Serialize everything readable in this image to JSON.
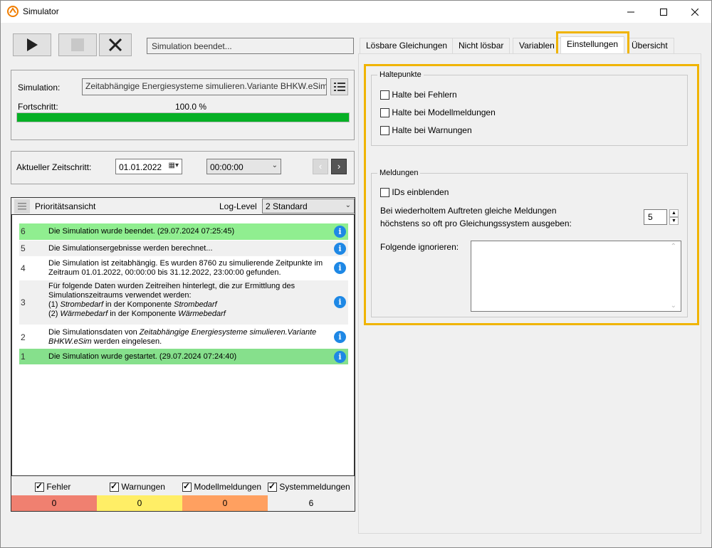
{
  "window": {
    "title": "Simulator"
  },
  "toolbar": {
    "status_text": "Simulation beendet..."
  },
  "simulation": {
    "label": "Simulation:",
    "value": "Zeitabhängige Energiesysteme simulieren.Variante BHKW.eSim",
    "progress_label": "Fortschritt:",
    "progress_text": "100.0 %",
    "progress_fraction": 1.0
  },
  "timestep": {
    "label": "Aktueller Zeitschritt:",
    "date": "01.01.2022",
    "time": "00:00:00"
  },
  "log": {
    "title": "Prioritätsansicht",
    "level_label": "Log-Level",
    "level_value": "2 Standard",
    "rows": [
      {
        "num": "6",
        "line1": "Die Simulation wurde beendet. (29.07.2024 07:25:45)"
      },
      {
        "num": "5",
        "line1": "Die Simulationsergebnisse werden berechnet..."
      },
      {
        "num": "4",
        "line1": "Die Simulation ist zeitabhängig. Es wurden 8760 zu simulierende Zeitpunkte im",
        "line2": "Zeitraum 01.01.2022, 00:00:00 bis 31.12.2022, 23:00:00 gefunden."
      },
      {
        "num": "3",
        "line1": "Für folgende Daten wurden Zeitreihen hinterlegt, die zur Ermittlung des",
        "line2": "Simulationszeitraums verwendet werden:",
        "line3a": "(1) ",
        "line3i1": "Strombedarf",
        "line3b": " in der Komponente ",
        "line3i2": "Strombedarf",
        "line4a": "(2) ",
        "line4i1": "Wärmebedarf",
        "line4b": " in der Komponente ",
        "line4i2": "Wärmebedarf"
      },
      {
        "num": "2",
        "line1a": "Die Simulationsdaten von ",
        "line1i": "Zeitabhängige Energiesysteme simulieren.Variante",
        "line2i": "BHKW.eSim",
        "line2b": " werden eingelesen."
      },
      {
        "num": "1",
        "line1": "Die Simulation wurde gestartet. (29.07.2024 07:24:40)"
      }
    ]
  },
  "filters": {
    "errors": "Fehler",
    "warnings": "Warnungen",
    "model": "Modellmeldungen",
    "system": "Systemmeldungen"
  },
  "counts": {
    "errors": "0",
    "warnings": "0",
    "model": "0",
    "system": "6"
  },
  "tabs": [
    "Lösbare Gleichungen",
    "Nicht lösbar",
    "Variablen",
    "Einstellungen",
    "Übersicht"
  ],
  "settings": {
    "breakpoints_title": "Haltepunkte",
    "bp_errors": "Halte bei Fehlern",
    "bp_model": "Halte bei Modellmeldungen",
    "bp_warnings": "Halte bei Warnungen",
    "messages_title": "Meldungen",
    "show_ids": "IDs einblenden",
    "repeat_line1": "Bei wiederholtem Auftreten gleiche Meldungen",
    "repeat_line2": "höchstens so oft pro Gleichungssystem ausgeben:",
    "repeat_value": "5",
    "ignore_label": "Folgende ignorieren:"
  },
  "colors": {
    "row_green": "#90ee90",
    "row_green_dark": "#86e08c",
    "error_cell": "#f08070",
    "warning_cell": "#ffee66",
    "model_cell": "#ffa060",
    "highlight": "#f0b400"
  }
}
